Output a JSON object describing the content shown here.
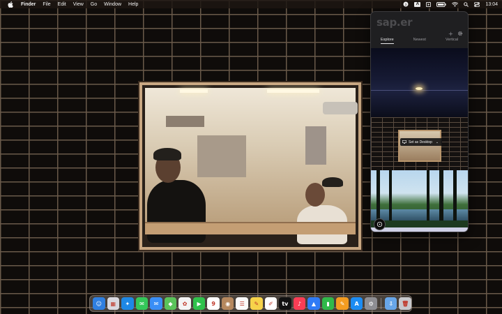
{
  "menubar": {
    "apple_icon": "apple-icon",
    "app_name": "Finder",
    "menus": [
      "File",
      "Edit",
      "View",
      "Go",
      "Window",
      "Help"
    ],
    "status": {
      "input_source": "A",
      "clock": "13:04"
    }
  },
  "popover": {
    "logo": "sap.er",
    "tabs": [
      {
        "label": "Explore",
        "active": true
      },
      {
        "label": "Newest",
        "active": false
      },
      {
        "label": "Vertical",
        "active": false
      }
    ],
    "set_desktop_label": "Set as Desktop",
    "calendar_date": "9"
  },
  "dock": {
    "apps": [
      {
        "name": "finder",
        "color": "#2f7fe0",
        "glyph": "☺"
      },
      {
        "name": "launchpad",
        "color": "#d9d9e0",
        "glyph": "▦"
      },
      {
        "name": "safari",
        "color": "#1e88e5",
        "glyph": "✦"
      },
      {
        "name": "messages",
        "color": "#34c759",
        "glyph": "✉"
      },
      {
        "name": "mail",
        "color": "#3a8ef6",
        "glyph": "✉"
      },
      {
        "name": "maps",
        "color": "#5ac35a",
        "glyph": "◆"
      },
      {
        "name": "photos",
        "color": "#f4f4f4",
        "glyph": "✿"
      },
      {
        "name": "facetime",
        "color": "#30c24c",
        "glyph": "▶"
      },
      {
        "name": "calendar",
        "color": "#ffffff",
        "glyph": "9"
      },
      {
        "name": "contacts",
        "color": "#b5885e",
        "glyph": "◉"
      },
      {
        "name": "reminders",
        "color": "#fafafa",
        "glyph": "☰"
      },
      {
        "name": "notes",
        "color": "#f7d34a",
        "glyph": "✎"
      },
      {
        "name": "freeform",
        "color": "#ffffff",
        "glyph": "✐"
      },
      {
        "name": "tv",
        "color": "#111111",
        "glyph": "tv"
      },
      {
        "name": "music",
        "color": "#fa3d55",
        "glyph": "♪"
      },
      {
        "name": "keynote",
        "color": "#2f7bf6",
        "glyph": "▲"
      },
      {
        "name": "numbers",
        "color": "#30b94a",
        "glyph": "▮"
      },
      {
        "name": "pages",
        "color": "#f39c21",
        "glyph": "✎"
      },
      {
        "name": "app-store",
        "color": "#1c8cf3",
        "glyph": "A"
      },
      {
        "name": "system-settings",
        "color": "#8e8e93",
        "glyph": "⚙"
      }
    ],
    "trailing": [
      {
        "name": "downloads",
        "color": "#68a6e8",
        "glyph": "⇩"
      },
      {
        "name": "trash",
        "color": "#c8c8cc",
        "glyph": "🗑"
      }
    ]
  }
}
